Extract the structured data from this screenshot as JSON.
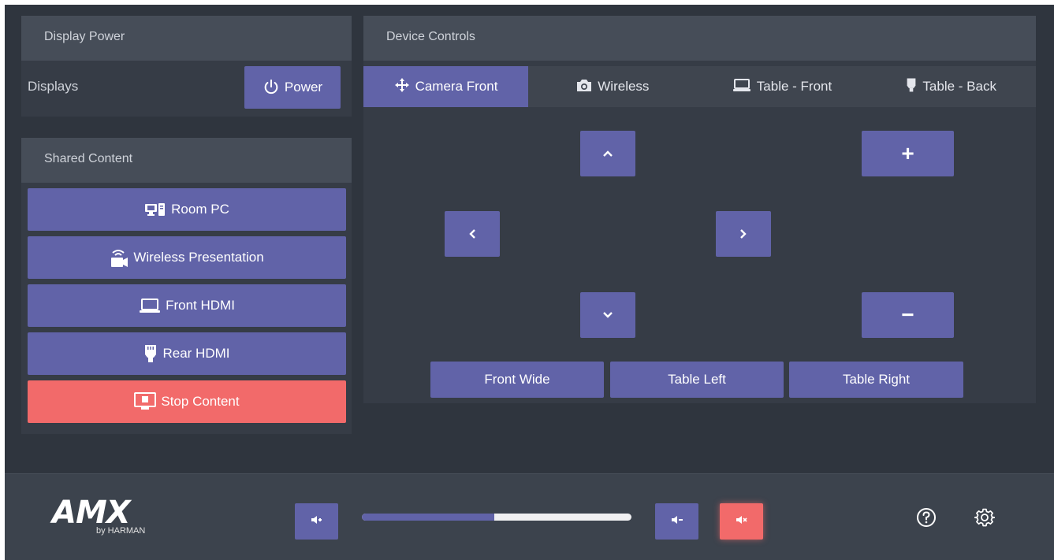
{
  "display_power": {
    "title": "Display Power",
    "displays_label": "Displays",
    "power_label": "Power",
    "power_icon": "power-icon"
  },
  "shared_content": {
    "title": "Shared Content",
    "sources": [
      {
        "label": "Room PC",
        "icon": "desktop-pc-icon"
      },
      {
        "label": "Wireless Presentation",
        "icon": "wireless-presentation-icon"
      },
      {
        "label": "Front HDMI",
        "icon": "laptop-icon"
      },
      {
        "label": "Rear HDMI",
        "icon": "hdmi-plug-icon"
      }
    ],
    "stop_label": "Stop Content",
    "stop_icon": "screen-stop-icon"
  },
  "device_controls": {
    "title": "Device Controls",
    "tabs": [
      {
        "label": "Camera Front",
        "icon": "move-arrows-icon",
        "active": true
      },
      {
        "label": "Wireless",
        "icon": "camera-icon",
        "active": false
      },
      {
        "label": "Table - Front",
        "icon": "laptop-icon",
        "active": false
      },
      {
        "label": "Table - Back",
        "icon": "hdmi-plug-icon",
        "active": false
      }
    ],
    "presets": [
      "Front Wide",
      "Table Left",
      "Table Right"
    ],
    "zoom_in": "+",
    "zoom_out": "−"
  },
  "footer": {
    "logo_main": "AMX",
    "logo_sub": "by HARMAN",
    "volume_level": 0.49,
    "mute_active": true,
    "colors": {
      "accent": "#6163a8",
      "alert": "#f26a6a",
      "background": "#2f353e"
    }
  }
}
